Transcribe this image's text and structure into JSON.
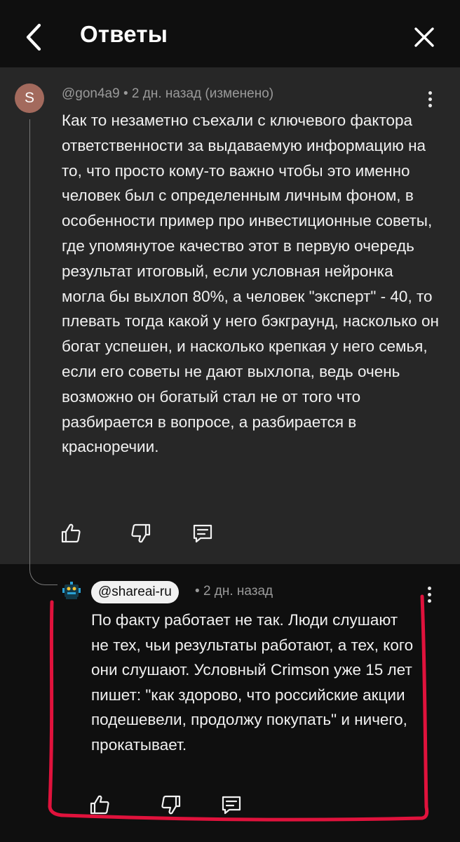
{
  "header": {
    "title": "Ответы"
  },
  "parent_comment": {
    "avatar_letter": "S",
    "author": "@gon4a9",
    "separator": " • ",
    "time": "2 дн. назад (изменено)",
    "text": "Как то незаметно съехали с ключевого фактора ответственности за выдаваемую информацию на то, что просто кому-то важно чтобы это именно человек был с определенным личным фоном, в особенности пример про инвестиционные советы, где упомянутое качество этот в первую очередь результат итоговый, если условная нейронка могла бы выхлоп 80%, а человек \"эксперт\" - 40, то плевать тогда какой у него бэкграунд, насколько он богат успешен, и насколько крепкая у него семья, если его советы не дают выхлопа, ведь очень возможно он богатый стал не от того что разбирается в вопросе, а разбирается в красноречии."
  },
  "reply": {
    "author": "@shareai-ru",
    "separator": "• ",
    "time": "2 дн. назад",
    "text": "По факту работает не так. Люди слушают не тех, чьи результаты работают, а тех, кого они слушают. Условный Crimson уже 15 лет пишет: \"как здорово, что российские акции подешевели, продолжу покупать\" и ничего, прокатывает."
  },
  "icons": {
    "back": "chevron-left-icon",
    "close": "close-icon",
    "more": "more-vertical-icon",
    "like": "thumbs-up-icon",
    "dislike": "thumbs-down-icon",
    "reply": "comment-icon"
  },
  "colors": {
    "background": "#0f0f0f",
    "parent_background": "#272727",
    "avatar_s": "#a36a5d",
    "annotation": "#e0123c"
  }
}
